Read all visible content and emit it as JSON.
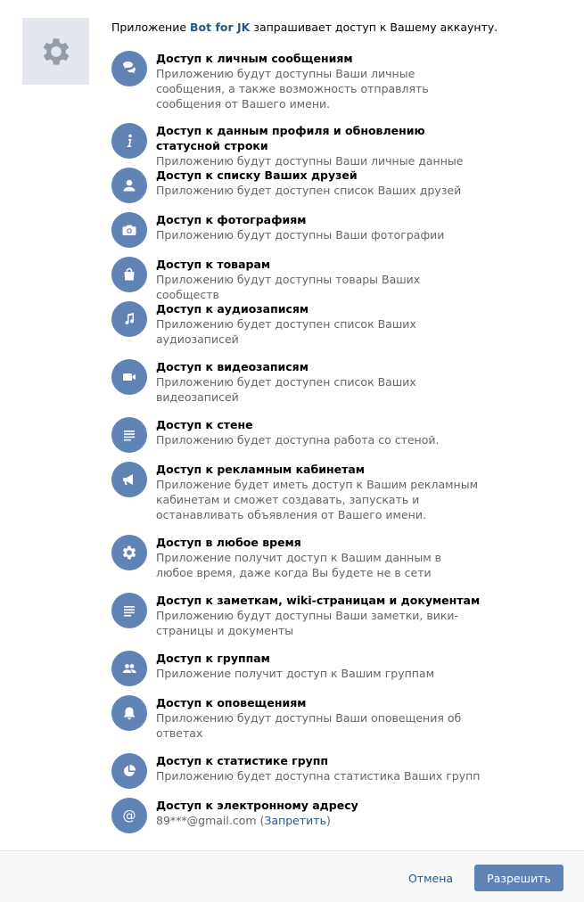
{
  "header": {
    "prefix": "Приложение ",
    "app_name": "Bot for JK",
    "suffix": " запрашивает доступ к Вашему аккаунту."
  },
  "app_icon": "gear-icon",
  "colors": {
    "accent": "#5f83b5",
    "link": "#2a5885",
    "muted": "#656565"
  },
  "permissions": [
    {
      "icon": "message-icon",
      "title": "Доступ к личным сообщениям",
      "desc": "Приложению будут доступны Ваши личные сообщения, а также возможность отправлять сообщения от Вашего имени."
    },
    {
      "icon": "info-icon",
      "title": "Доступ к данным профиля и обновлению статусной строки",
      "desc": "Приложению будут доступны Ваши личные данные"
    },
    {
      "icon": "user-icon",
      "title": "Доступ к списку Ваших друзей",
      "desc": "Приложению будет доступен список Ваших друзей"
    },
    {
      "icon": "camera-icon",
      "title": "Доступ к фотографиям",
      "desc": "Приложению будут доступны Ваши фотографии"
    },
    {
      "icon": "shopping-bag-icon",
      "title": "Доступ к товарам",
      "desc": "Приложению будут доступны товары Ваших сообществ"
    },
    {
      "icon": "music-note-icon",
      "title": "Доступ к аудиозаписям",
      "desc": "Приложению будет доступен список Ваших аудиозаписей"
    },
    {
      "icon": "video-camera-icon",
      "title": "Доступ к видеозаписям",
      "desc": "Приложению будет доступен список Ваших видеозаписей"
    },
    {
      "icon": "lines-icon",
      "title": "Доступ к стене",
      "desc": "Приложению будет доступна работа со стеной."
    },
    {
      "icon": "megaphone-icon",
      "title": "Доступ к рекламным кабинетам",
      "desc": "Приложение будет иметь доступ к Вашим рекламным кабинетам и сможет создавать, запускать и останавливать объявления от Вашего имени."
    },
    {
      "icon": "gear-icon",
      "title": "Доступ в любое время",
      "desc": "Приложение получит доступ к Вашим данным в любое время, даже когда Вы будете не в сети"
    },
    {
      "icon": "document-icon",
      "title": "Доступ к заметкам, wiki-страницам и документам",
      "desc": "Приложению будут доступны Ваши заметки, вики-страницы и документы"
    },
    {
      "icon": "group-icon",
      "title": "Доступ к группам",
      "desc": "Приложение получит доступ к Вашим группам"
    },
    {
      "icon": "bell-icon",
      "title": "Доступ к оповещениям",
      "desc": "Приложению будут доступны Ваши оповещения об ответах"
    },
    {
      "icon": "pie-chart-icon",
      "title": "Доступ к статистике групп",
      "desc": "Приложению будет доступна статистика Ваших групп"
    },
    {
      "icon": "at-sign-icon",
      "title": "Доступ к электронному адресу",
      "email": "89***@gmail.com",
      "paren_open": " (",
      "deny_link": "Запретить",
      "paren_close": ")"
    }
  ],
  "footer": {
    "cancel_label": "Отмена",
    "allow_label": "Разрешить"
  }
}
